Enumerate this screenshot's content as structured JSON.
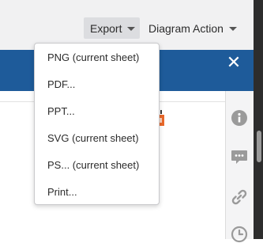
{
  "toolbar": {
    "export_label": "Export",
    "diagram_action_label": "Diagram Action"
  },
  "export_menu": {
    "items": [
      {
        "label": "PNG (current sheet)"
      },
      {
        "label": "PDF..."
      },
      {
        "label": "PPT..."
      },
      {
        "label": "SVG (current sheet)"
      },
      {
        "label": "PS... (current sheet)"
      },
      {
        "label": "Print..."
      }
    ]
  },
  "colors": {
    "header_blue": "#1e5b9a",
    "toolbar_bg": "#f1f1f2",
    "side_icon": "#9a9a9a",
    "orange_accent": "#e8682a"
  },
  "side_panel": {
    "icons": [
      "info-icon",
      "comment-icon",
      "link-icon",
      "history-icon"
    ]
  }
}
